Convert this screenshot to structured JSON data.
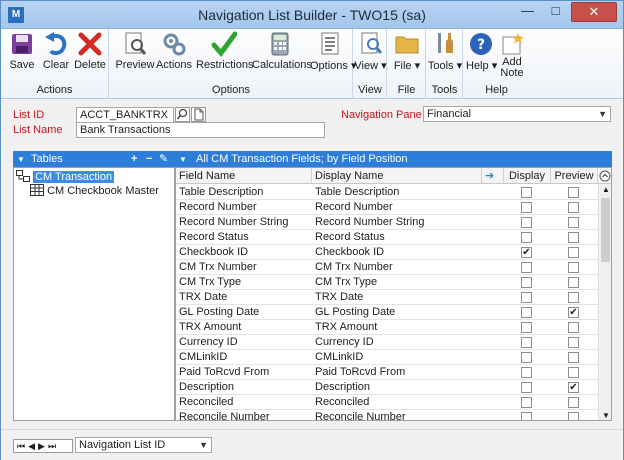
{
  "window": {
    "title": "Navigation List Builder  -  TWO15 (sa)",
    "app_icon_label": "M"
  },
  "ribbon": {
    "groups": {
      "actions": {
        "label": "Actions",
        "buttons": [
          "Save",
          "Clear",
          "Delete"
        ]
      },
      "options": {
        "label": "Options",
        "buttons": [
          "Preview",
          "Actions",
          "Restrictions",
          "Calculations",
          "Options"
        ]
      },
      "view": {
        "label": "View",
        "buttons": [
          "View"
        ]
      },
      "file": {
        "label": "File",
        "buttons": [
          "File"
        ]
      },
      "tools": {
        "label": "Tools",
        "buttons": [
          "Tools"
        ]
      },
      "help": {
        "label": "Help",
        "buttons": [
          "Help",
          "Add",
          "Note"
        ]
      }
    }
  },
  "form": {
    "list_id_label": "List ID",
    "list_id_value": "ACCT_BANKTRX",
    "list_name_label": "List Name",
    "list_name_value": "Bank Transactions",
    "navigation_pane_label": "Navigation Pane",
    "navigation_pane_value": "Financial"
  },
  "tables_pane": {
    "header": "Tables",
    "items": [
      "CM Transaction",
      "CM Checkbook Master"
    ]
  },
  "fields_pane": {
    "header": "All CM Transaction Fields; by Field Position",
    "columns": {
      "field_name": "Field Name",
      "display_name": "Display Name",
      "display": "Display",
      "preview": "Preview"
    },
    "rows": [
      {
        "field": "Table Description",
        "display_name": "Table Description",
        "display": false,
        "preview": false
      },
      {
        "field": "Record Number",
        "display_name": "Record Number",
        "display": false,
        "preview": false
      },
      {
        "field": "Record Number String",
        "display_name": "Record Number String",
        "display": false,
        "preview": false
      },
      {
        "field": "Record Status",
        "display_name": "Record Status",
        "display": false,
        "preview": false
      },
      {
        "field": "Checkbook ID",
        "display_name": "Checkbook ID",
        "display": true,
        "preview": false
      },
      {
        "field": "CM Trx Number",
        "display_name": "CM Trx Number",
        "display": false,
        "preview": false
      },
      {
        "field": "CM Trx Type",
        "display_name": "CM Trx Type",
        "display": false,
        "preview": false
      },
      {
        "field": "TRX Date",
        "display_name": "TRX Date",
        "display": false,
        "preview": false
      },
      {
        "field": "GL Posting Date",
        "display_name": "GL Posting Date",
        "display": false,
        "preview": true
      },
      {
        "field": "TRX Amount",
        "display_name": "TRX Amount",
        "display": false,
        "preview": false
      },
      {
        "field": "Currency ID",
        "display_name": "Currency ID",
        "display": false,
        "preview": false
      },
      {
        "field": "CMLinkID",
        "display_name": "CMLinkID",
        "display": false,
        "preview": false
      },
      {
        "field": "Paid ToRcvd From",
        "display_name": "Paid ToRcvd From",
        "display": false,
        "preview": false
      },
      {
        "field": "Description",
        "display_name": "Description",
        "display": false,
        "preview": true
      },
      {
        "field": "Reconciled",
        "display_name": "Reconciled",
        "display": false,
        "preview": false
      },
      {
        "field": "Reconcile Number",
        "display_name": "Reconcile Number",
        "display": false,
        "preview": false
      }
    ]
  },
  "bottom": {
    "sort_select_value": "Navigation List ID"
  },
  "colors": {
    "accent_blue": "#2d7ddb",
    "label_red": "#c8161d",
    "close_red": "#c7514a"
  }
}
